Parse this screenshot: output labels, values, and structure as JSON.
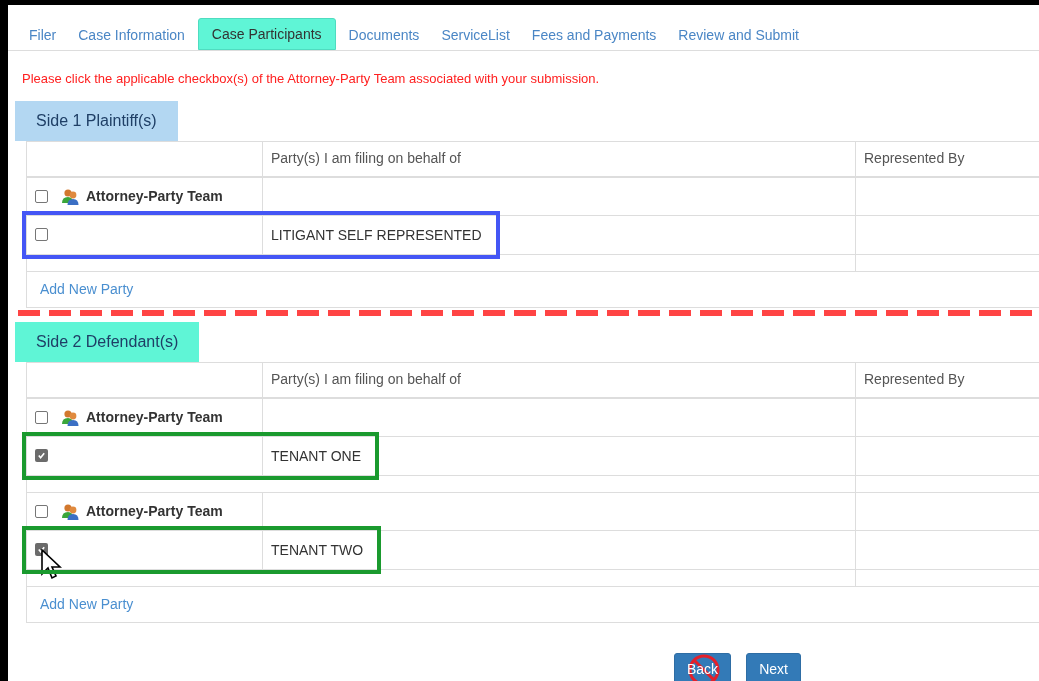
{
  "tabs": [
    {
      "label": "Filer",
      "selected": false
    },
    {
      "label": "Case Information",
      "selected": false
    },
    {
      "label": "Case Participants",
      "selected": true
    },
    {
      "label": "Documents",
      "selected": false
    },
    {
      "label": "ServiceList",
      "selected": false
    },
    {
      "label": "Fees and Payments",
      "selected": false
    },
    {
      "label": "Review and Submit",
      "selected": false
    }
  ],
  "instruction": "Please click the applicable checkbox(s) of the Attorney-Party Team associated with your submission.",
  "sides": [
    {
      "title": "Side 1 Plaintiff(s)",
      "color": "#b3d7f2",
      "columns": [
        "Party(s) I am filing on behalf of",
        "Represented By"
      ],
      "groups": [
        {
          "team": {
            "label": "Attorney-Party Team",
            "checked": false
          },
          "parties": [
            {
              "name": "LITIGANT SELF REPRESENTED",
              "checked": false,
              "color": "#4456f5",
              "pointer": false
            }
          ]
        }
      ],
      "add_link": "Add New Party",
      "divider_after": true
    },
    {
      "title": "Side 2 Defendant(s)",
      "color": "#5ff5d6",
      "columns": [
        "Party(s) I am filing on behalf of",
        "Represented By"
      ],
      "groups": [
        {
          "team": {
            "label": "Attorney-Party Team",
            "checked": false
          },
          "parties": [
            {
              "name": "TENANT ONE",
              "checked": true,
              "color": "#1a9a2e",
              "pointer": false
            }
          ]
        },
        {
          "team": {
            "label": "Attorney-Party Team",
            "checked": false
          },
          "parties": [
            {
              "name": "TENANT TWO",
              "checked": true,
              "color": "#1a9a2e",
              "pointer": true
            }
          ]
        }
      ],
      "add_link": "Add New Party",
      "divider_after": false
    }
  ],
  "buttons": [
    {
      "label": "Back",
      "blocked": true
    },
    {
      "label": "Next",
      "blocked": false
    }
  ]
}
